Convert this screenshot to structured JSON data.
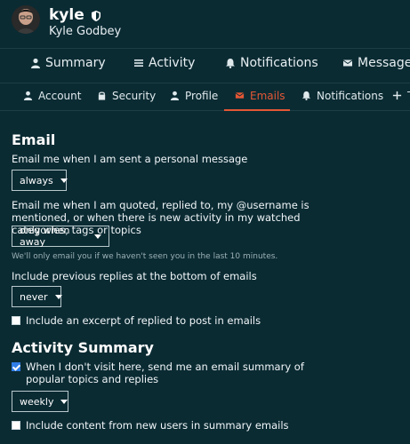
{
  "user": {
    "username": "kyle",
    "fullname": "Kyle Godbey"
  },
  "nav": {
    "items": [
      {
        "label": "Summary",
        "icon": "user-icon"
      },
      {
        "label": "Activity",
        "icon": "stream-icon"
      },
      {
        "label": "Notifications",
        "icon": "bell-icon"
      },
      {
        "label": "Messages",
        "icon": "envelope-icon"
      }
    ]
  },
  "subnav": {
    "items": [
      {
        "label": "Account",
        "icon": "user-icon"
      },
      {
        "label": "Security",
        "icon": "lock-icon"
      },
      {
        "label": "Profile",
        "icon": "user-icon"
      },
      {
        "label": "Emails",
        "icon": "envelope-icon",
        "active": true
      },
      {
        "label": "Notifications",
        "icon": "bell-icon"
      },
      {
        "label": "T",
        "icon": "plus-icon"
      }
    ]
  },
  "email_section": {
    "title": "Email",
    "pm_label": "Email me when I am sent a personal message",
    "pm_value": "always",
    "quoted_label": "Email me when I am quoted, replied to, my @username is mentioned, or when there is new activity in my watched categories, tags or topics",
    "quoted_value": "only when away",
    "quoted_hint": "We'll only email you if we haven't seen you in the last 10 minutes.",
    "prev_label": "Include previous replies at the bottom of emails",
    "prev_value": "never",
    "excerpt_label": "Include an excerpt of replied to post in emails",
    "excerpt_checked": false
  },
  "activity_section": {
    "title": "Activity Summary",
    "summary_label": "When I don't visit here, send me an email summary of popular topics and replies",
    "summary_checked": true,
    "freq_value": "weekly",
    "new_users_label": "Include content from new users in summary emails",
    "new_users_checked": false
  },
  "colors": {
    "background": "#0b2b33",
    "accent": "#e45735",
    "checkbox_checked": "#2f7ee8"
  }
}
